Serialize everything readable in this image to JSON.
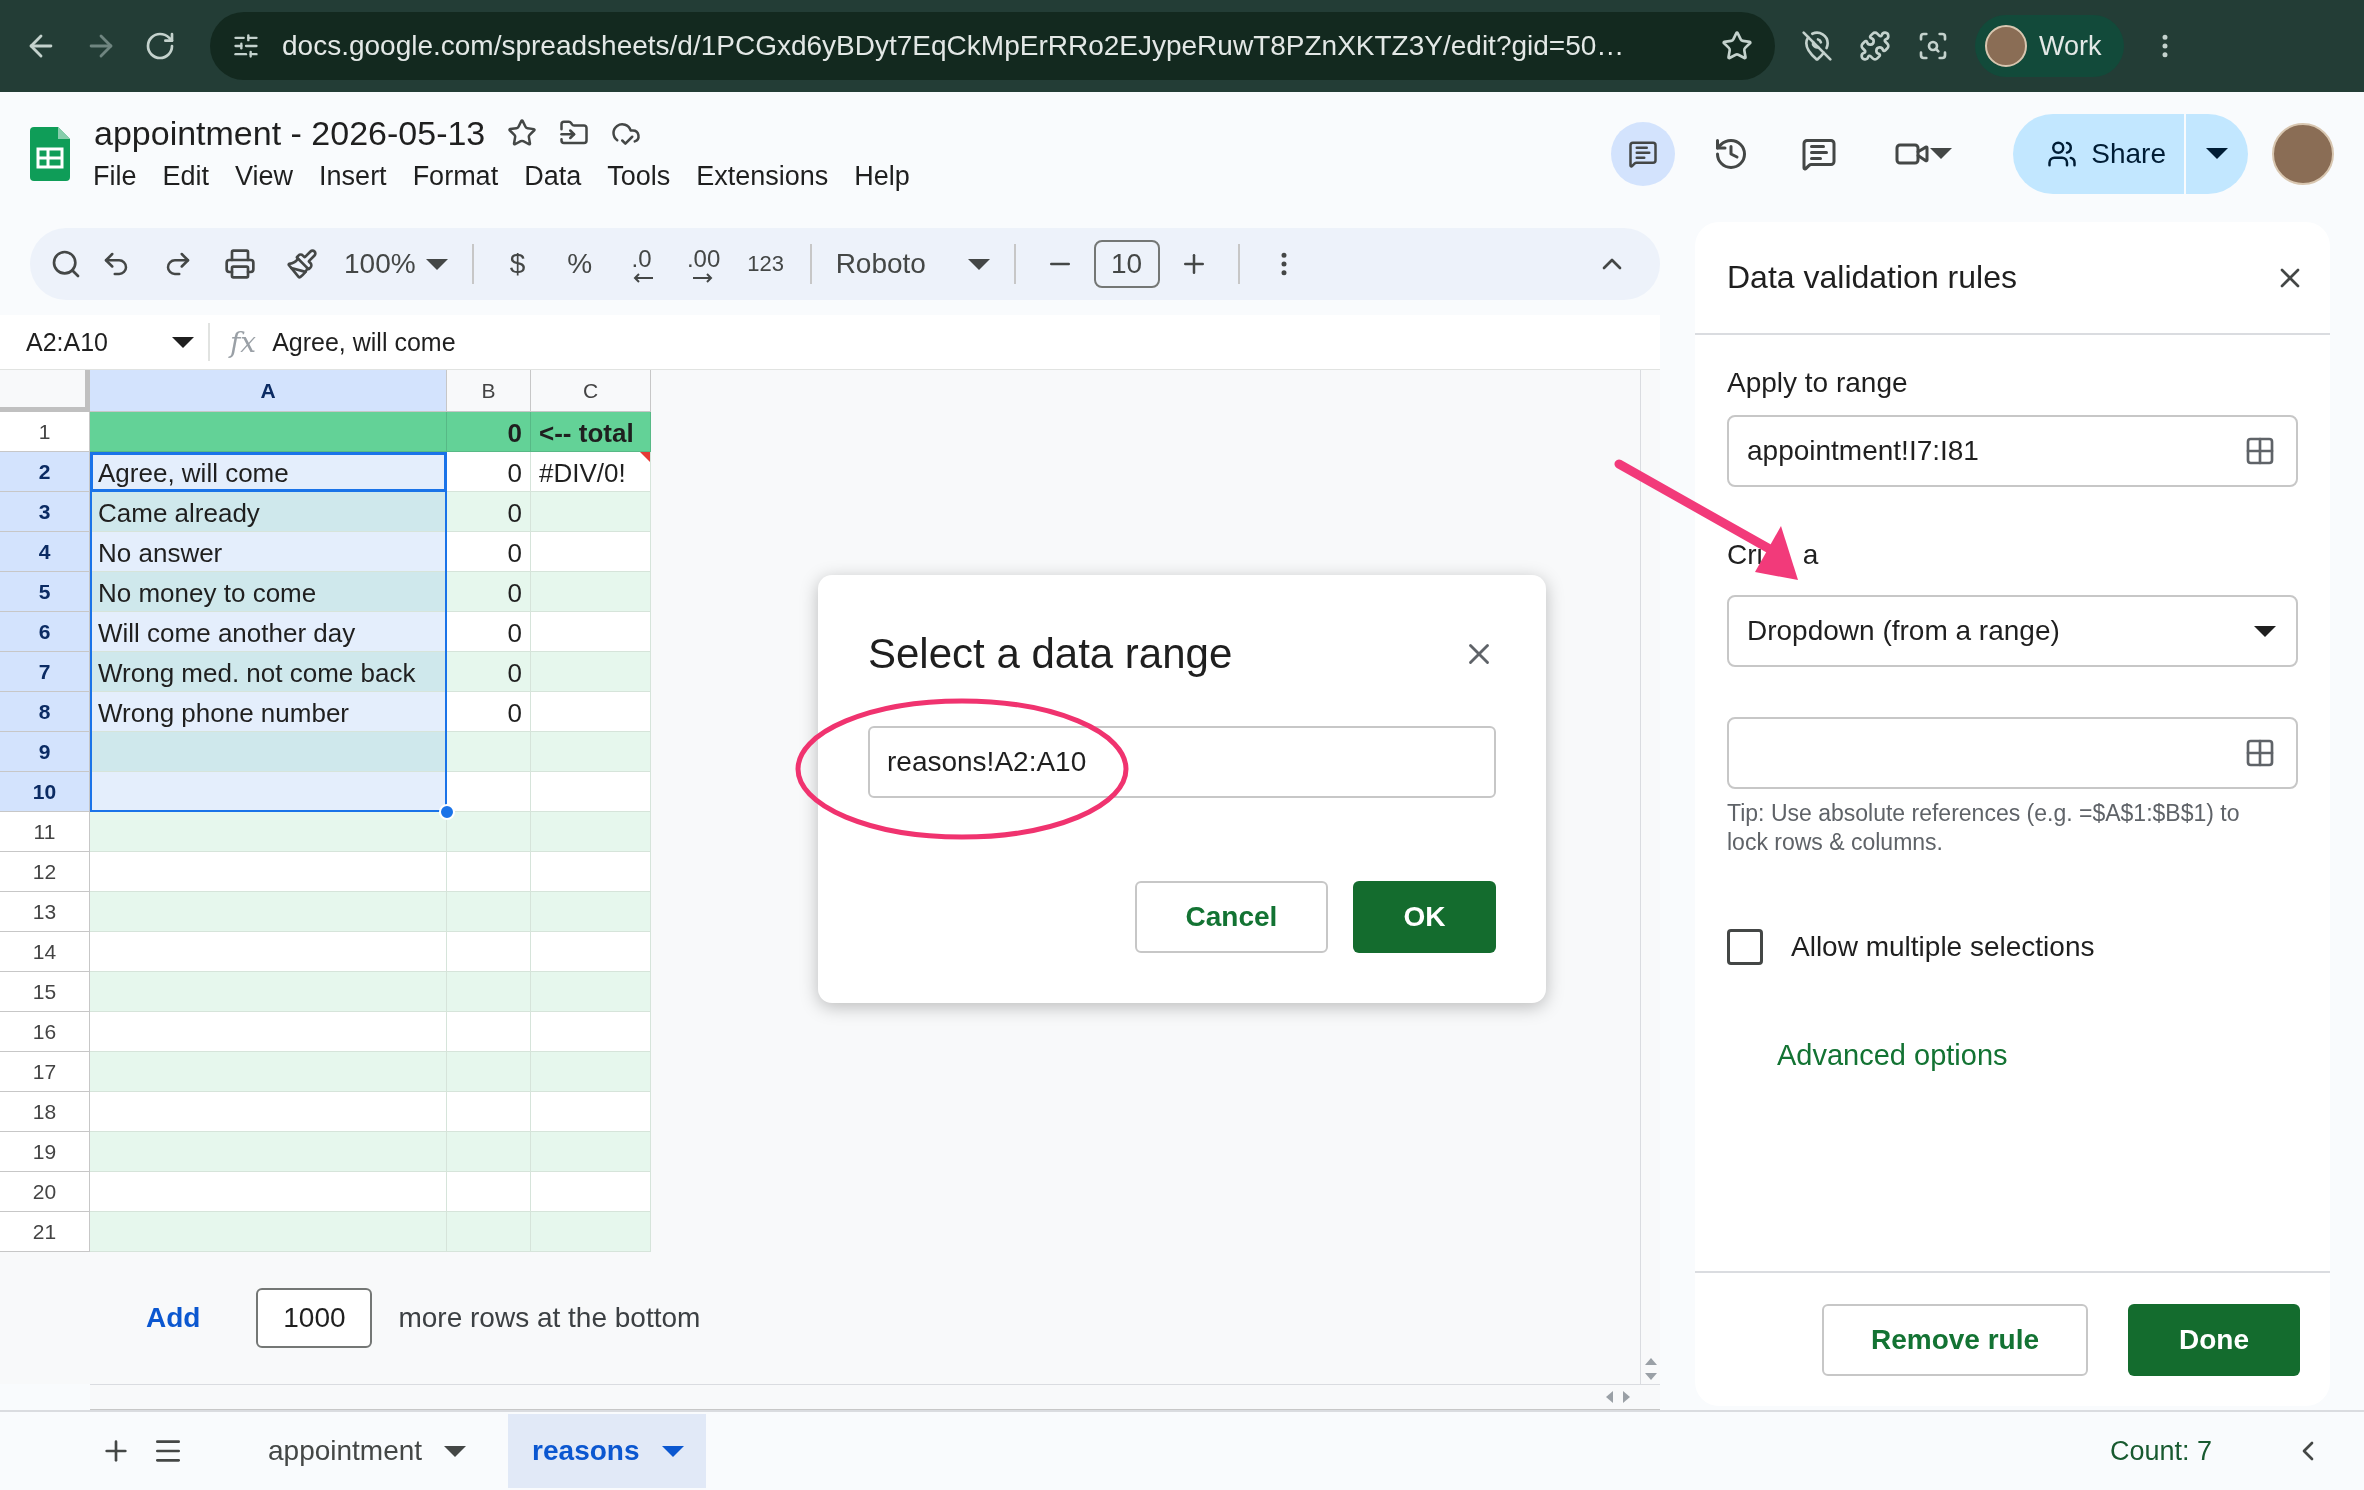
{
  "browser": {
    "url": "docs.google.com/spreadsheets/d/1PCGxd6yBDyt7EqCkMpErRRo2EJypeRuwT8PZnXKTZ3Y/edit?gid=50…",
    "profile": "Work"
  },
  "doc": {
    "title": "appointment - 2026-05-13",
    "menu": [
      "File",
      "Edit",
      "View",
      "Insert",
      "Format",
      "Data",
      "Tools",
      "Extensions",
      "Help"
    ],
    "share": "Share"
  },
  "toolbar": {
    "zoom": "100%",
    "currency": "$",
    "percent": "%",
    "decrease_decimals": ".0",
    "increase_decimals": ".00",
    "number_format": "123",
    "font": "Roboto",
    "font_size": "10"
  },
  "formula_bar": {
    "name_box": "A2:A10",
    "fx": "fx",
    "value": "Agree, will come"
  },
  "grid": {
    "columns": [
      {
        "label": "A",
        "selected": true
      },
      {
        "label": "B",
        "selected": false
      },
      {
        "label": "C",
        "selected": false
      }
    ],
    "rows": [
      {
        "number": "1",
        "kind": "total",
        "selected": false,
        "active": false,
        "error": false,
        "cells": [
          "",
          "0",
          "<-- total"
        ]
      },
      {
        "number": "2",
        "kind": "data",
        "selected": true,
        "active": true,
        "error": true,
        "cells": [
          "Agree, will come",
          "0",
          "#DIV/0!"
        ]
      },
      {
        "number": "3",
        "kind": "data",
        "selected": true,
        "active": false,
        "error": false,
        "cells": [
          "Came already",
          "0",
          ""
        ]
      },
      {
        "number": "4",
        "kind": "data",
        "selected": true,
        "active": false,
        "error": false,
        "cells": [
          "No answer",
          "0",
          ""
        ]
      },
      {
        "number": "5",
        "kind": "data",
        "selected": true,
        "active": false,
        "error": false,
        "cells": [
          "No money to come",
          "0",
          ""
        ]
      },
      {
        "number": "6",
        "kind": "data",
        "selected": true,
        "active": false,
        "error": false,
        "cells": [
          "Will come another day",
          "0",
          ""
        ]
      },
      {
        "number": "7",
        "kind": "data",
        "selected": true,
        "active": false,
        "error": false,
        "cells": [
          "Wrong med. not come back",
          "0",
          ""
        ]
      },
      {
        "number": "8",
        "kind": "data",
        "selected": true,
        "active": false,
        "error": false,
        "cells": [
          "Wrong phone number",
          "0",
          ""
        ]
      },
      {
        "number": "9",
        "kind": "data",
        "selected": true,
        "active": false,
        "error": false,
        "cells": [
          "",
          "",
          ""
        ]
      },
      {
        "number": "10",
        "kind": "data",
        "selected": true,
        "active": false,
        "error": false,
        "cells": [
          "",
          "",
          ""
        ]
      },
      {
        "number": "11",
        "kind": "data",
        "selected": false,
        "active": false,
        "error": false,
        "cells": [
          "",
          "",
          ""
        ]
      },
      {
        "number": "12",
        "kind": "data",
        "selected": false,
        "active": false,
        "error": false,
        "cells": [
          "",
          "",
          ""
        ]
      },
      {
        "number": "13",
        "kind": "data",
        "selected": false,
        "active": false,
        "error": false,
        "cells": [
          "",
          "",
          ""
        ]
      },
      {
        "number": "14",
        "kind": "data",
        "selected": false,
        "active": false,
        "error": false,
        "cells": [
          "",
          "",
          ""
        ]
      },
      {
        "number": "15",
        "kind": "data",
        "selected": false,
        "active": false,
        "error": false,
        "cells": [
          "",
          "",
          ""
        ]
      },
      {
        "number": "16",
        "kind": "data",
        "selected": false,
        "active": false,
        "error": false,
        "cells": [
          "",
          "",
          ""
        ]
      },
      {
        "number": "17",
        "kind": "data",
        "selected": false,
        "active": false,
        "error": false,
        "cells": [
          "",
          "",
          ""
        ]
      },
      {
        "number": "18",
        "kind": "data",
        "selected": false,
        "active": false,
        "error": false,
        "cells": [
          "",
          "",
          ""
        ]
      },
      {
        "number": "19",
        "kind": "data",
        "selected": false,
        "active": false,
        "error": false,
        "cells": [
          "",
          "",
          ""
        ]
      },
      {
        "number": "20",
        "kind": "data",
        "selected": false,
        "active": false,
        "error": false,
        "cells": [
          "",
          "",
          ""
        ]
      },
      {
        "number": "21",
        "kind": "data",
        "selected": false,
        "active": false,
        "error": false,
        "cells": [
          "",
          "",
          ""
        ]
      }
    ]
  },
  "add_rows": {
    "button": "Add",
    "count": "1000",
    "label": "more rows at the bottom"
  },
  "sheet_tabs": [
    {
      "label": "appointment",
      "selected": false
    },
    {
      "label": "reasons",
      "selected": true
    }
  ],
  "status": "Count: 7",
  "panel": {
    "title": "Data validation rules",
    "apply_label": "Apply to range",
    "apply_value": "appointment!I7:I81",
    "criteria_label": "Cri",
    "criteria_label_end": "a",
    "criteria_value": "Dropdown (from a range)",
    "tip": "Tip: Use absolute references (e.g. =$A$1:$B$1) to lock rows & columns.",
    "allow_multiple": {
      "label": "Allow multiple selections",
      "checked": false
    },
    "advanced": "Advanced options",
    "remove": "Remove rule",
    "done": "Done"
  },
  "dialog": {
    "title": "Select a data range",
    "value": "reasons!A2:A10",
    "cancel": "Cancel",
    "ok": "OK"
  }
}
